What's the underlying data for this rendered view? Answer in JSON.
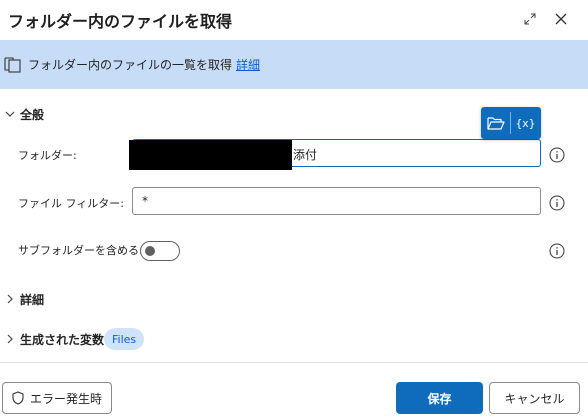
{
  "dialog": {
    "title": "フォルダー内のファイルを取得",
    "expand_icon": "expand-icon",
    "close_icon": "close-icon"
  },
  "info": {
    "text": "フォルダー内のファイルの一覧を取得",
    "link": "詳細"
  },
  "sections": {
    "general": "全般",
    "details": "詳細",
    "variables": "生成された変数"
  },
  "fields": {
    "folder_label": "フォルダー:",
    "folder_value_visible": "添付",
    "filter_label": "ファイル フィルター:",
    "filter_value": "*",
    "include_subfolders_label": "サブフォルダーを含める:",
    "include_subfolders": false
  },
  "popup": {
    "folder_icon": "folder-open-icon",
    "variable_label": "{x}"
  },
  "variables_badge": "Files",
  "footer": {
    "error_button": "エラー発生時",
    "save_button": "保存",
    "cancel_button": "キャンセル"
  },
  "colors": {
    "accent": "#0f6cbd",
    "info_background": "#c7dcf7",
    "badge_background": "#cfe4fa"
  }
}
